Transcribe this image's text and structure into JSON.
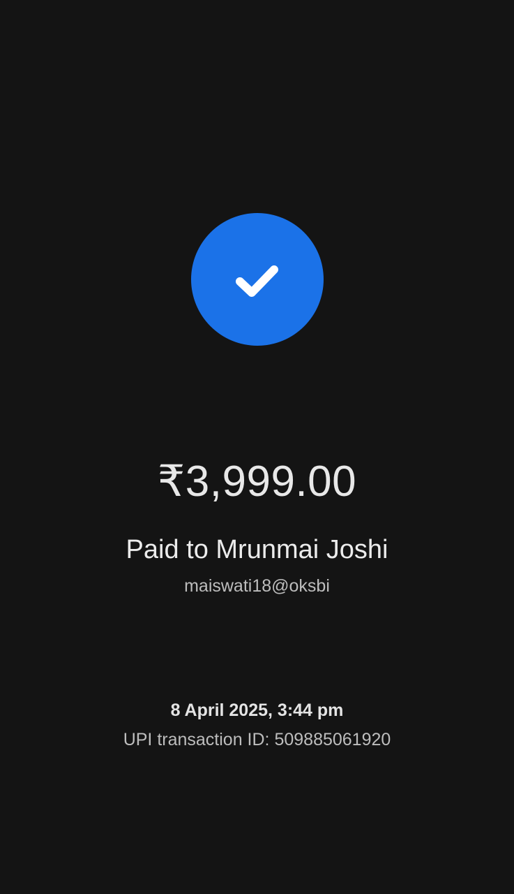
{
  "colors": {
    "background": "#141414",
    "accent": "#1b72e8",
    "primary_text": "#e8e8e8",
    "secondary_text": "#bdbdbd"
  },
  "status_icon": "check-icon",
  "payment": {
    "amount": "₹3,999.00",
    "paid_to": "Paid to Mrunmai Joshi",
    "upi_id": "maiswati18@oksbi",
    "datetime": "8 April 2025, 3:44 pm",
    "transaction": "UPI transaction ID: 509885061920"
  }
}
